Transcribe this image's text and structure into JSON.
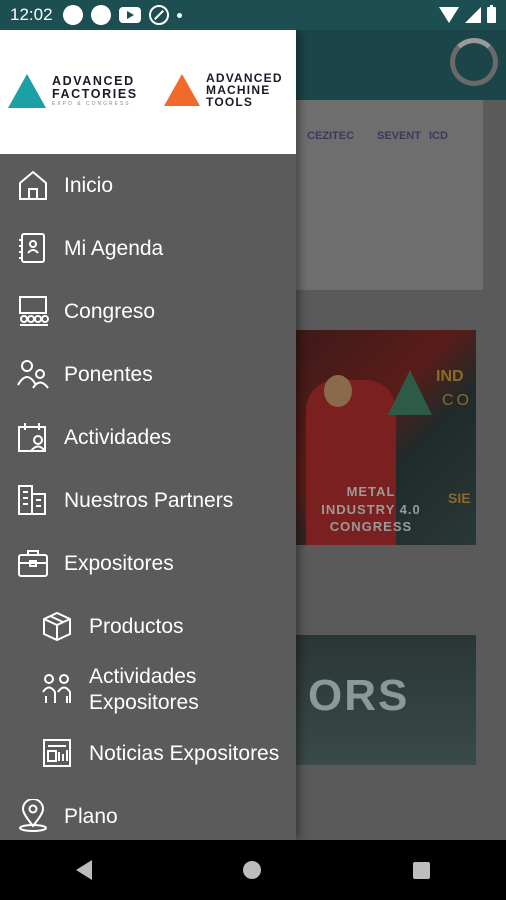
{
  "status_bar": {
    "time": "12:02",
    "icons": [
      "notification-dot-icon",
      "notification-dot-icon",
      "youtube-icon",
      "do-not-disturb-icon",
      "small-dot-icon",
      "wifi-icon",
      "signal-icon",
      "battery-icon"
    ]
  },
  "drawer": {
    "header": {
      "brand_left": {
        "line1": "ADVANCED",
        "line2": "FACTORIES",
        "line3": "EXPO & CONGRESS",
        "color": "#1aa0a6"
      },
      "brand_right": {
        "line1": "ADVANCED",
        "line2": "MACHINE",
        "line3": "TOOLS",
        "color": "#f26a2b"
      }
    },
    "items": [
      {
        "label": "Inicio",
        "icon": "home-icon"
      },
      {
        "label": "Mi Agenda",
        "icon": "agenda-icon"
      },
      {
        "label": "Congreso",
        "icon": "congress-icon"
      },
      {
        "label": "Ponentes",
        "icon": "speakers-icon"
      },
      {
        "label": "Actividades",
        "icon": "activities-icon"
      },
      {
        "label": "Nuestros Partners",
        "icon": "partners-icon"
      },
      {
        "label": "Expositores",
        "icon": "briefcase-icon"
      },
      {
        "label": "Productos",
        "icon": "box-icon"
      },
      {
        "label": "Actividades\nExpositores",
        "icon": "exhibitor-activities-icon"
      },
      {
        "label": "Noticias Expositores",
        "icon": "news-icon"
      },
      {
        "label": "Plano",
        "icon": "map-pin-icon"
      }
    ]
  },
  "background": {
    "sponsor_logos": [
      "CEZITEC",
      "SEVENT",
      "ICD"
    ],
    "promo_1": {
      "tag_a": "IND",
      "tag_b": "CO",
      "caption_line1": "METAL",
      "caption_line2": "INDUSTRY 4.0",
      "caption_line3": "CONGRESS",
      "side_text": "SIE"
    },
    "promo_2": {
      "text": "ORS"
    }
  },
  "colors": {
    "accent": "#1aa0a6",
    "accent_secondary": "#f26a2b",
    "drawer_bg": "#5b5b5b",
    "status_bar": "#1c4e52"
  }
}
